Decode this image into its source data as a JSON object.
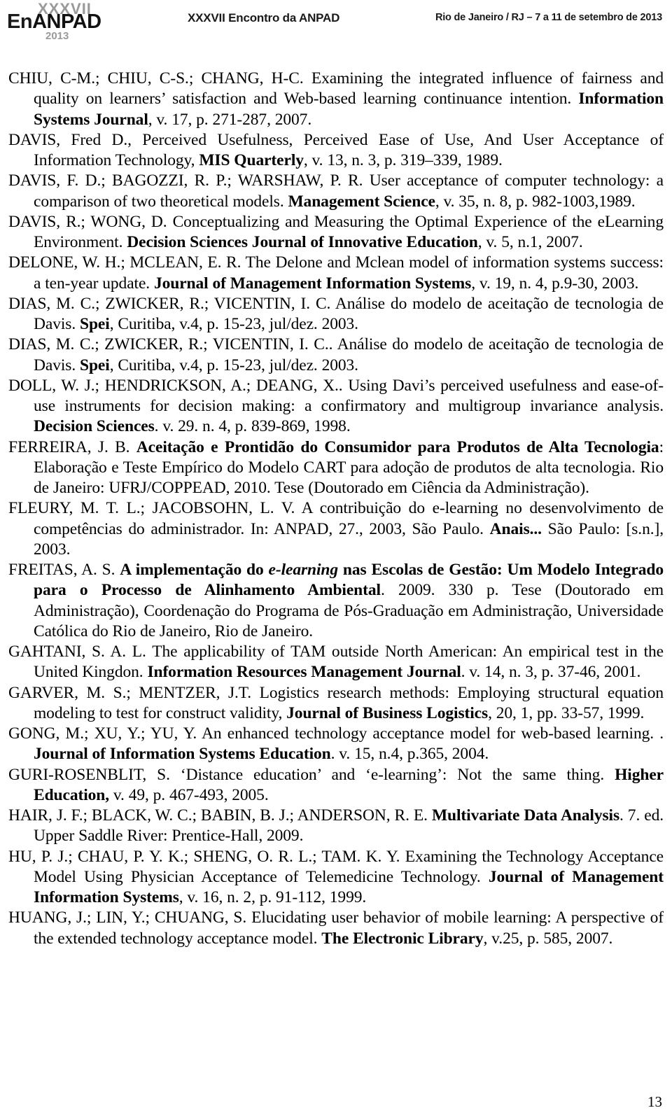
{
  "header": {
    "logo": {
      "roman": "XXXVII",
      "main_prefix": "En",
      "main_suffix": "ANPAD",
      "year": "2013"
    },
    "center_title": "XXXVII Encontro da ANPAD",
    "right_info": "Rio de Janeiro / RJ – 7 a 11 de setembro de 2013"
  },
  "page_number": "13",
  "references": [
    {
      "id": "chiu-2007",
      "parts": [
        {
          "text": "CHIU, C-M.; CHIU, C-S.; CHANG, H-C. Examining the integrated influence of fairness and quality on learners’ satisfaction and Web-based learning continuance intention. ",
          "style": "normal"
        },
        {
          "text": "Information Systems Journal",
          "style": "bold"
        },
        {
          "text": ", v. 17, p. 271-287, 2007.",
          "style": "normal"
        }
      ]
    },
    {
      "id": "davis-1989",
      "parts": [
        {
          "text": "DAVIS, Fred D., Perceived Usefulness, Perceived Ease of Use, And User Acceptance of Information Technology, ",
          "style": "normal"
        },
        {
          "text": "MIS Quarterly",
          "style": "bold"
        },
        {
          "text": ", v. 13, n. 3, p. 319–339, 1989.",
          "style": "normal"
        }
      ]
    },
    {
      "id": "davis-bagozzi-warshaw-1989",
      "parts": [
        {
          "text": "DAVIS, F. D.; BAGOZZI, R. P.; WARSHAW, P. R. User acceptance of computer technology: a comparison of two theoretical models. ",
          "style": "normal"
        },
        {
          "text": "Management Science",
          "style": "bold"
        },
        {
          "text": ", v. 35, n. 8, p. 982-1003,1989.",
          "style": "normal"
        }
      ]
    },
    {
      "id": "davis-wong-2007",
      "parts": [
        {
          "text": "DAVIS, R.; WONG, D. Conceptualizing and Measuring the Optimal Experience of the eLearning Environment. ",
          "style": "normal"
        },
        {
          "text": "Decision Sciences Journal of Innovative Education",
          "style": "bold"
        },
        {
          "text": ", v. 5, n.1, 2007.",
          "style": "normal"
        }
      ]
    },
    {
      "id": "delone-mclean-2003",
      "parts": [
        {
          "text": "DELONE, W. H.; MCLEAN, E. R. The Delone and Mclean model of information systems success: a ten-year update. ",
          "style": "normal"
        },
        {
          "text": "Journal of Management Information Systems",
          "style": "bold"
        },
        {
          "text": ", v. 19, n. 4, p.9-30, 2003.",
          "style": "normal"
        }
      ]
    },
    {
      "id": "dias-zwicker-vicentin-2003-a",
      "parts": [
        {
          "text": "DIAS, M. C.; ZWICKER, R.; VICENTIN, I. C. Análise do modelo de aceitação de tecnologia de Davis. ",
          "style": "normal"
        },
        {
          "text": "Spei",
          "style": "bold"
        },
        {
          "text": ", Curitiba, v.4, p. 15-23, jul/dez. 2003.",
          "style": "normal"
        }
      ]
    },
    {
      "id": "dias-zwicker-vicentin-2003-b",
      "parts": [
        {
          "text": "DIAS, M. C.; ZWICKER, R.; VICENTIN, I. C.. Análise do modelo de aceitação de tecnologia de Davis. ",
          "style": "normal"
        },
        {
          "text": "Spei",
          "style": "bold"
        },
        {
          "text": ", Curitiba, v.4, p. 15-23, jul/dez. 2003.",
          "style": "normal"
        }
      ]
    },
    {
      "id": "doll-hendrickson-deang-1998",
      "parts": [
        {
          "text": "DOLL, W. J.; HENDRICKSON, A.; DEANG, X.. Using Davi’s perceived usefulness and ease-of-use instruments for decision making: a confirmatory and multigroup invariance analysis. ",
          "style": "normal"
        },
        {
          "text": "Decision Sciences",
          "style": "bold"
        },
        {
          "text": ". v. 29. n. 4, p. 839-869, 1998.",
          "style": "normal"
        }
      ]
    },
    {
      "id": "ferreira-2010",
      "parts": [
        {
          "text": "FERREIRA, J. B. ",
          "style": "normal"
        },
        {
          "text": "Aceitação e Prontidão do Consumidor para Produtos de Alta Tecnologia",
          "style": "bold"
        },
        {
          "text": ": Elaboração e Teste Empírico do Modelo CART para adoção de produtos de alta tecnologia. Rio de Janeiro: UFRJ/COPPEAD, 2010. Tese (Doutorado em Ciência da Administração).",
          "style": "normal"
        }
      ]
    },
    {
      "id": "fleury-jacobsohn-2003",
      "parts": [
        {
          "text": "FLEURY, M. T. L.; JACOBSOHN, L. V. A contribuição do e-learning no desenvolvimento de competências do administrador. In: ANPAD, 27., 2003, São Paulo. ",
          "style": "normal"
        },
        {
          "text": "Anais...",
          "style": "bold"
        },
        {
          "text": " São Paulo: [s.n.], 2003.",
          "style": "normal"
        }
      ]
    },
    {
      "id": "freitas-2009",
      "parts": [
        {
          "text": "FREITAS, A. S. ",
          "style": "normal"
        },
        {
          "text": "A implementação do ",
          "style": "bold"
        },
        {
          "text": "e-learning",
          "style": "bold-italic"
        },
        {
          "text": " nas Escolas de Gestão: Um Modelo Integrado para o Processo de Alinhamento Ambiental",
          "style": "bold"
        },
        {
          "text": ". 2009. 330 p. Tese (Doutorado em Administração), Coordenação do Programa de Pós-Graduação em Administração, Universidade Católica do Rio de Janeiro, Rio de Janeiro.",
          "style": "normal"
        }
      ]
    },
    {
      "id": "gahtani-2001",
      "parts": [
        {
          "text": "GAHTANI, S. A. L. The applicability of TAM outside North American: An empirical test in the United Kingdon. ",
          "style": "normal"
        },
        {
          "text": "Information Resources Management Journal",
          "style": "bold"
        },
        {
          "text": ". v. 14, n. 3, p. 37-46, 2001.",
          "style": "normal"
        }
      ]
    },
    {
      "id": "garver-mentzer-1999",
      "parts": [
        {
          "text": "GARVER, M. S.; MENTZER, J.T. Logistics research methods: Employing structural equation modeling to test for construct validity, ",
          "style": "normal"
        },
        {
          "text": "Journal of Business Logistics",
          "style": "bold"
        },
        {
          "text": ", 20, 1, pp. 33-57, 1999.",
          "style": "normal"
        }
      ]
    },
    {
      "id": "gong-xu-yu-2004",
      "parts": [
        {
          "text": "GONG, M.; XU, Y.; YU, Y. An enhanced technology acceptance model for web-based learning. . ",
          "style": "normal"
        },
        {
          "text": "Journal of Information Systems Education",
          "style": "bold"
        },
        {
          "text": ". v. 15, n.4, p.365, 2004.",
          "style": "normal"
        }
      ]
    },
    {
      "id": "guri-rosenblit-2005",
      "parts": [
        {
          "text": "GURI-ROSENBLIT, S. ‘Distance education’ and ‘e-learning’: Not the same thing. ",
          "style": "normal"
        },
        {
          "text": "Higher Education,",
          "style": "bold"
        },
        {
          "text": " v. 49, p. 467-493, 2005.",
          "style": "normal"
        }
      ]
    },
    {
      "id": "hair-2009",
      "parts": [
        {
          "text": "HAIR, J. F.; BLACK, W. C.; BABIN, B. J.; ANDERSON, R. E. ",
          "style": "normal"
        },
        {
          "text": "Multivariate Data Analysis",
          "style": "bold"
        },
        {
          "text": ". 7. ed. Upper Saddle River: Prentice-Hall, 2009.",
          "style": "normal"
        }
      ]
    },
    {
      "id": "hu-chau-sheng-tam-1999",
      "parts": [
        {
          "text": "HU, P. J.; CHAU, P. Y. K.; SHENG, O. R. L.; TAM. K. Y. Examining the Technology Acceptance Model Using Physician Acceptance of Telemedicine Technology. ",
          "style": "normal"
        },
        {
          "text": "Journal of Management Information Systems",
          "style": "bold"
        },
        {
          "text": ", v. 16, n. 2, p. 91-112, 1999.",
          "style": "normal"
        }
      ]
    },
    {
      "id": "huang-lin-chuang-2007",
      "parts": [
        {
          "text": "HUANG, J.; LIN, Y.; CHUANG, S. Elucidating user behavior of mobile learning: A perspective of the extended technology acceptance model. ",
          "style": "normal"
        },
        {
          "text": "The Electronic Library",
          "style": "bold"
        },
        {
          "text": ", v.25, p. 585, 2007.",
          "style": "normal"
        }
      ]
    }
  ]
}
